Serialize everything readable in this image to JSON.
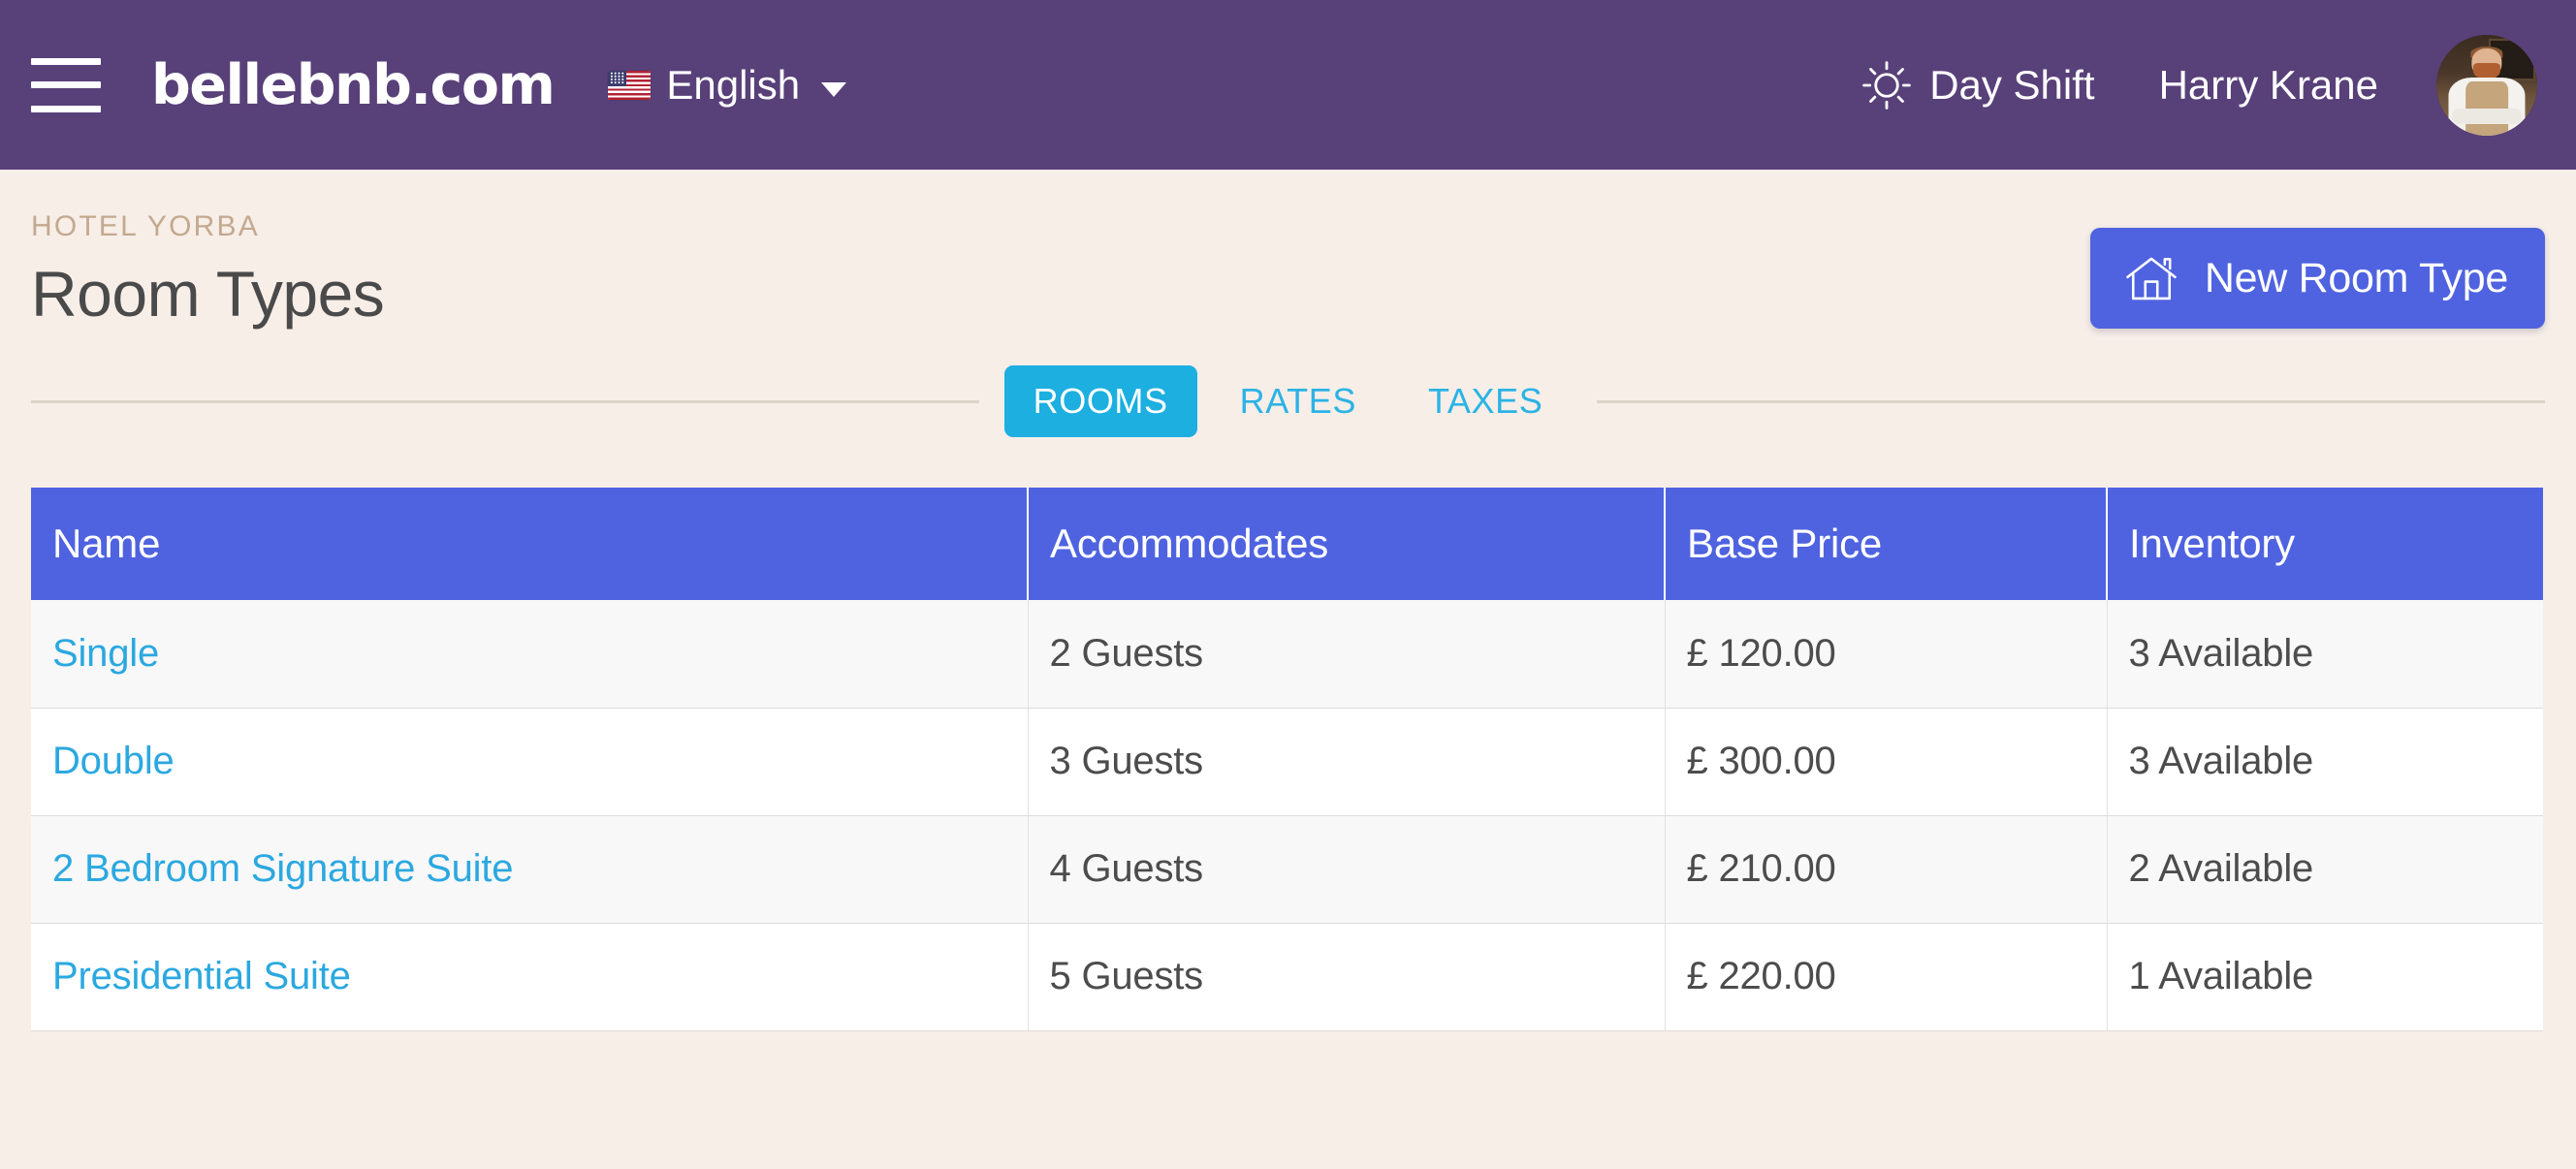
{
  "topbar": {
    "menu_icon": "hamburger-icon",
    "brand": "bellebnb.com",
    "language": {
      "flag_icon": "us-flag-icon",
      "label": "English",
      "caret_icon": "chevron-down-icon"
    },
    "shift": {
      "icon": "sun-icon",
      "label": "Day Shift"
    },
    "user": {
      "name": "Harry Krane",
      "avatar_icon": "avatar"
    },
    "colors": {
      "background": "#584079",
      "text": "#ffffff"
    }
  },
  "page": {
    "eyebrow": "HOTEL YORBA",
    "title": "Room Types",
    "new_button": {
      "label": "New Room Type",
      "icon": "home-icon",
      "color": "#4f63e0"
    },
    "background": "#f7eee8"
  },
  "tabs": {
    "items": [
      {
        "label": "ROOMS",
        "active": true
      },
      {
        "label": "RATES",
        "active": false
      },
      {
        "label": "TAXES",
        "active": false
      }
    ],
    "active_color": "#1cafe0",
    "link_color": "#2bb3e5"
  },
  "table": {
    "columns": [
      "Name",
      "Accommodates",
      "Base Price",
      "Inventory"
    ],
    "header_color": "#4f63e0",
    "link_color": "#2ba8e0",
    "rows": [
      {
        "name": "Single",
        "accommodates": "2 Guests",
        "base_price": "£ 120.00",
        "inventory": "3 Available"
      },
      {
        "name": "Double",
        "accommodates": "3 Guests",
        "base_price": "£ 300.00",
        "inventory": "3 Available"
      },
      {
        "name": "2 Bedroom Signature Suite",
        "accommodates": "4 Guests",
        "base_price": "£ 210.00",
        "inventory": "2 Available"
      },
      {
        "name": "Presidential Suite",
        "accommodates": "5 Guests",
        "base_price": "£ 220.00",
        "inventory": "1 Available"
      }
    ]
  }
}
